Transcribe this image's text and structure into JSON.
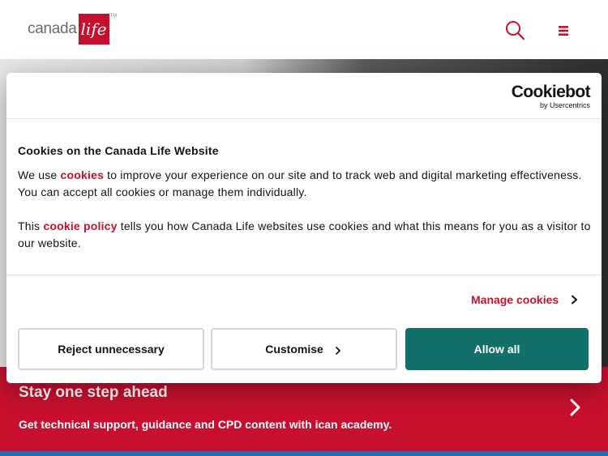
{
  "header": {
    "logo_text": "canada",
    "logo_mark": "life",
    "logo_tm": "TM",
    "search_icon": "search-icon",
    "menu_icon": "hamburger-menu-icon"
  },
  "banner": {
    "title": "Stay one step ahead",
    "subtitle": "Get technical support, guidance and CPD content with ican academy."
  },
  "cookie_dialog": {
    "brand_main": "Cookiebot",
    "brand_sub": "by Usercentrics",
    "title": "Cookies on the Canada Life Website",
    "p1_before": "We use ",
    "p1_link": "cookies",
    "p1_after": " to improve your experience on our site and to track web and digital marketing effectiveness. You can accept all cookies or manage them individually.",
    "p2_before": "This ",
    "p2_link": "cookie policy",
    "p2_after": " tells you how Canada Life websites use cookies and what this means for you as a visitor to our website.",
    "manage_label": "Manage cookies",
    "buttons": {
      "reject": "Reject unnecessary",
      "customise": "Customise",
      "allow": "Allow all"
    }
  },
  "colors": {
    "brand_red": "#c8102e",
    "allow_teal": "#136f6a"
  }
}
